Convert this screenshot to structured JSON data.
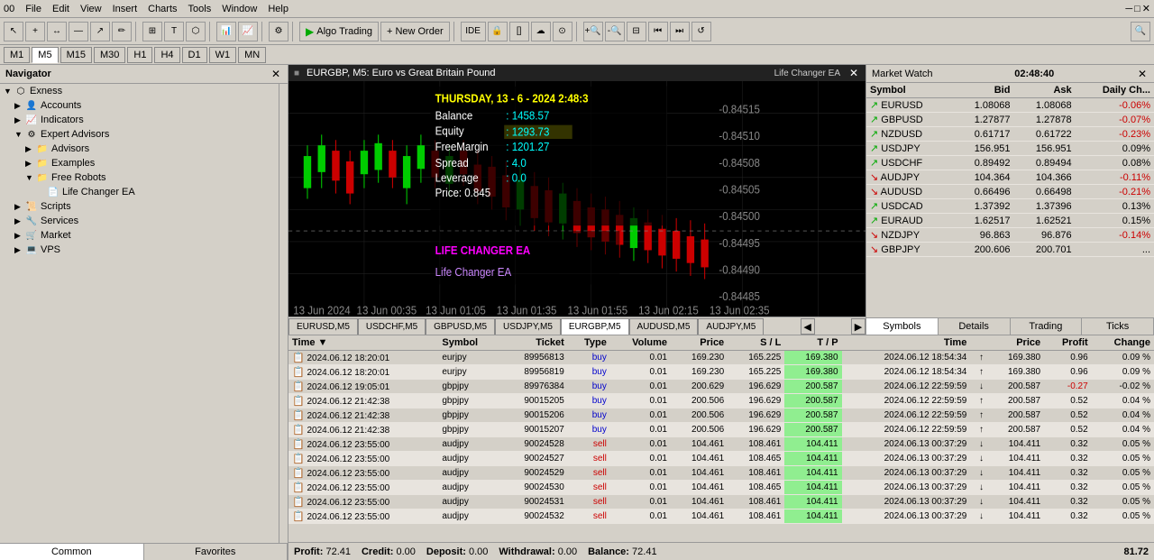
{
  "menubar": {
    "items": [
      "File",
      "Edit",
      "View",
      "Insert",
      "Charts",
      "Tools",
      "Window",
      "Help"
    ]
  },
  "toolbar": {
    "buttons": [
      "↖",
      "+",
      "↔",
      "—",
      "↗",
      "✏",
      "⊞",
      "T",
      "⬡"
    ],
    "algo_label": "Algo Trading",
    "new_order_label": "New Order",
    "ide_label": "IDE"
  },
  "timeframes": {
    "tabs": [
      "M1",
      "M5",
      "M15",
      "M30",
      "H1",
      "H4",
      "D1",
      "W1",
      "MN"
    ],
    "active": "M5"
  },
  "navigator": {
    "title": "Navigator",
    "sections": [
      {
        "label": "Exness",
        "icon": "⬡",
        "indent": 0,
        "expanded": true
      },
      {
        "label": "Accounts",
        "icon": "👤",
        "indent": 1,
        "expanded": false
      },
      {
        "label": "Indicators",
        "icon": "📈",
        "indent": 1,
        "expanded": false
      },
      {
        "label": "Expert Advisors",
        "icon": "⚙",
        "indent": 1,
        "expanded": true
      },
      {
        "label": "Advisors",
        "icon": "📁",
        "indent": 2,
        "expanded": false
      },
      {
        "label": "Examples",
        "icon": "📁",
        "indent": 2,
        "expanded": false
      },
      {
        "label": "Free Robots",
        "icon": "📁",
        "indent": 2,
        "expanded": true
      },
      {
        "label": "Life Changer EA",
        "icon": "📄",
        "indent": 3,
        "expanded": false
      },
      {
        "label": "Scripts",
        "icon": "📜",
        "indent": 1,
        "expanded": false
      },
      {
        "label": "Services",
        "icon": "🔧",
        "indent": 1,
        "expanded": false
      },
      {
        "label": "Market",
        "icon": "🛒",
        "indent": 1,
        "expanded": false
      },
      {
        "label": "VPS",
        "icon": "💻",
        "indent": 1,
        "expanded": false
      }
    ],
    "tabs": [
      "Common",
      "Favorites"
    ],
    "active_tab": "Common"
  },
  "chart": {
    "title": "EURGBP, M5: Euro vs Great Britain Pound",
    "ea_label": "Life Changer EA",
    "info": {
      "date": "THURSDAY, 13 - 6 - 2024 2:48:3",
      "balance_label": "Balance",
      "balance_value": "1458.57",
      "equity_label": "Equity",
      "equity_value": "1293.73",
      "freemargin_label": "FreeMargin",
      "freemargin_value": "1201.27",
      "spread_label": "Spread",
      "spread_value": "4.0",
      "leverage_label": "Leverage",
      "leverage_value": "0.0",
      "price_label": "Price:",
      "price_value": "0.845"
    },
    "ea_overlay": "LIFE CHANGER EA",
    "price_scale": [
      "-0.84515",
      "-0.84510",
      "-0.84508",
      "-0.84505",
      "-0.84500",
      "-0.84495",
      "-0.84490",
      "-0.84485"
    ],
    "tabs": [
      "EURUSD,M5",
      "USDCHF,M5",
      "GBPUSD,M5",
      "USDJPY,M5",
      "EURGBP,M5",
      "AUDUSD,M5",
      "AUDJPY,M5"
    ],
    "active_tab": "EURGBP,M5"
  },
  "market_watch": {
    "title": "Market Watch",
    "time": "02:48:40",
    "columns": [
      "Symbol",
      "Bid",
      "Ask",
      "Daily Ch..."
    ],
    "symbols": [
      {
        "name": "EURUSD",
        "direction": "up",
        "bid": "1.08068",
        "ask": "1.08068",
        "change": "-0.06%",
        "neg": true
      },
      {
        "name": "GBPUSD",
        "direction": "up",
        "bid": "1.27877",
        "ask": "1.27878",
        "change": "-0.07%",
        "neg": true
      },
      {
        "name": "NZDUSD",
        "direction": "up",
        "bid": "0.61717",
        "ask": "0.61722",
        "change": "-0.23%",
        "neg": true
      },
      {
        "name": "USDJPY",
        "direction": "up",
        "bid": "156.951",
        "ask": "156.951",
        "change": "0.09%",
        "neg": false
      },
      {
        "name": "USDCHF",
        "direction": "up",
        "bid": "0.89492",
        "ask": "0.89494",
        "change": "0.08%",
        "neg": false
      },
      {
        "name": "AUDJPY",
        "direction": "down",
        "bid": "104.364",
        "ask": "104.366",
        "change": "-0.11%",
        "neg": true
      },
      {
        "name": "AUDUSD",
        "direction": "down",
        "bid": "0.66496",
        "ask": "0.66498",
        "change": "-0.21%",
        "neg": true
      },
      {
        "name": "USDCAD",
        "direction": "up",
        "bid": "1.37392",
        "ask": "1.37396",
        "change": "0.13%",
        "neg": false
      },
      {
        "name": "EURAUD",
        "direction": "up",
        "bid": "1.62517",
        "ask": "1.62521",
        "change": "0.15%",
        "neg": false
      },
      {
        "name": "NZDJPY",
        "direction": "down",
        "bid": "96.863",
        "ask": "96.876",
        "change": "-0.14%",
        "neg": true
      },
      {
        "name": "GBPJPY",
        "direction": "down",
        "bid": "200.606",
        "ask": "200.701",
        "change": "...",
        "neg": false
      }
    ],
    "tabs": [
      "Symbols",
      "Details",
      "Trading",
      "Ticks"
    ],
    "active_tab": "Symbols"
  },
  "trades": {
    "columns": [
      "Time",
      "Symbol",
      "Ticket",
      "Type",
      "Volume",
      "Price",
      "S / L",
      "T / P",
      "Time",
      "",
      "Price",
      "Profit",
      "Change"
    ],
    "rows": [
      {
        "open_time": "2024.06.12 18:20:01",
        "symbol": "eurjpy",
        "ticket": "89956813",
        "type": "buy",
        "volume": "0.01",
        "price": "169.230",
        "sl": "165.225",
        "tp": "169.380",
        "close_time": "2024.06.12 18:54:34",
        "arrow": "↑",
        "close_price": "169.380",
        "profit": "0.96",
        "change": "0.09 %"
      },
      {
        "open_time": "2024.06.12 18:20:01",
        "symbol": "eurjpy",
        "ticket": "89956819",
        "type": "buy",
        "volume": "0.01",
        "price": "169.230",
        "sl": "165.225",
        "tp": "169.380",
        "close_time": "2024.06.12 18:54:34",
        "arrow": "↑",
        "close_price": "169.380",
        "profit": "0.96",
        "change": "0.09 %"
      },
      {
        "open_time": "2024.06.12 19:05:01",
        "symbol": "gbpjpy",
        "ticket": "89976384",
        "type": "buy",
        "volume": "0.01",
        "price": "200.629",
        "sl": "196.629",
        "tp": "200.587",
        "close_time": "2024.06.12 22:59:59",
        "arrow": "↓",
        "close_price": "200.587",
        "profit": "-0.27",
        "change": "-0.02 %"
      },
      {
        "open_time": "2024.06.12 21:42:38",
        "symbol": "gbpjpy",
        "ticket": "90015205",
        "type": "buy",
        "volume": "0.01",
        "price": "200.506",
        "sl": "196.629",
        "tp": "200.587",
        "close_time": "2024.06.12 22:59:59",
        "arrow": "↑",
        "close_price": "200.587",
        "profit": "0.52",
        "change": "0.04 %"
      },
      {
        "open_time": "2024.06.12 21:42:38",
        "symbol": "gbpjpy",
        "ticket": "90015206",
        "type": "buy",
        "volume": "0.01",
        "price": "200.506",
        "sl": "196.629",
        "tp": "200.587",
        "close_time": "2024.06.12 22:59:59",
        "arrow": "↑",
        "close_price": "200.587",
        "profit": "0.52",
        "change": "0.04 %"
      },
      {
        "open_time": "2024.06.12 21:42:38",
        "symbol": "gbpjpy",
        "ticket": "90015207",
        "type": "buy",
        "volume": "0.01",
        "price": "200.506",
        "sl": "196.629",
        "tp": "200.587",
        "close_time": "2024.06.12 22:59:59",
        "arrow": "↑",
        "close_price": "200.587",
        "profit": "0.52",
        "change": "0.04 %"
      },
      {
        "open_time": "2024.06.12 23:55:00",
        "symbol": "audjpy",
        "ticket": "90024528",
        "type": "sell",
        "volume": "0.01",
        "price": "104.461",
        "sl": "108.461",
        "tp": "104.411",
        "close_time": "2024.06.13 00:37:29",
        "arrow": "↓",
        "close_price": "104.411",
        "profit": "0.32",
        "change": "0.05 %"
      },
      {
        "open_time": "2024.06.12 23:55:00",
        "symbol": "audjpy",
        "ticket": "90024527",
        "type": "sell",
        "volume": "0.01",
        "price": "104.461",
        "sl": "108.465",
        "tp": "104.411",
        "close_time": "2024.06.13 00:37:29",
        "arrow": "↓",
        "close_price": "104.411",
        "profit": "0.32",
        "change": "0.05 %"
      },
      {
        "open_time": "2024.06.12 23:55:00",
        "symbol": "audjpy",
        "ticket": "90024529",
        "type": "sell",
        "volume": "0.01",
        "price": "104.461",
        "sl": "108.461",
        "tp": "104.411",
        "close_time": "2024.06.13 00:37:29",
        "arrow": "↓",
        "close_price": "104.411",
        "profit": "0.32",
        "change": "0.05 %"
      },
      {
        "open_time": "2024.06.12 23:55:00",
        "symbol": "audjpy",
        "ticket": "90024530",
        "type": "sell",
        "volume": "0.01",
        "price": "104.461",
        "sl": "108.465",
        "tp": "104.411",
        "close_time": "2024.06.13 00:37:29",
        "arrow": "↓",
        "close_price": "104.411",
        "profit": "0.32",
        "change": "0.05 %"
      },
      {
        "open_time": "2024.06.12 23:55:00",
        "symbol": "audjpy",
        "ticket": "90024531",
        "type": "sell",
        "volume": "0.01",
        "price": "104.461",
        "sl": "108.461",
        "tp": "104.411",
        "close_time": "2024.06.13 00:37:29",
        "arrow": "↓",
        "close_price": "104.411",
        "profit": "0.32",
        "change": "0.05 %"
      },
      {
        "open_time": "2024.06.12 23:55:00",
        "symbol": "audjpy",
        "ticket": "90024532",
        "type": "sell",
        "volume": "0.01",
        "price": "104.461",
        "sl": "108.461",
        "tp": "104.411",
        "close_time": "2024.06.13 00:37:29",
        "arrow": "↓",
        "close_price": "104.411",
        "profit": "0.32",
        "change": "0.05 %"
      }
    ]
  },
  "statusbar": {
    "profit_label": "Profit:",
    "profit_value": "72.41",
    "credit_label": "Credit:",
    "credit_value": "0.00",
    "deposit_label": "Deposit:",
    "deposit_value": "0.00",
    "withdrawal_label": "Withdrawal:",
    "withdrawal_value": "0.00",
    "balance_label": "Balance:",
    "balance_value": "72.41",
    "right_value": "81.72"
  }
}
